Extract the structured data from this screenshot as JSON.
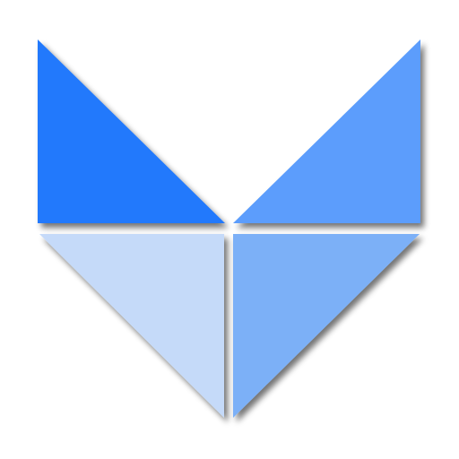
{
  "logo": {
    "shape": "four-triangle heart/chevron mark",
    "colors": {
      "top_left": "#2079fc",
      "top_right": "#5b9dfc",
      "bottom_left": "#c5daf9",
      "bottom_right": "#7cb0f7",
      "shadow": "#8a8a8a",
      "background": "#ffffff"
    }
  }
}
